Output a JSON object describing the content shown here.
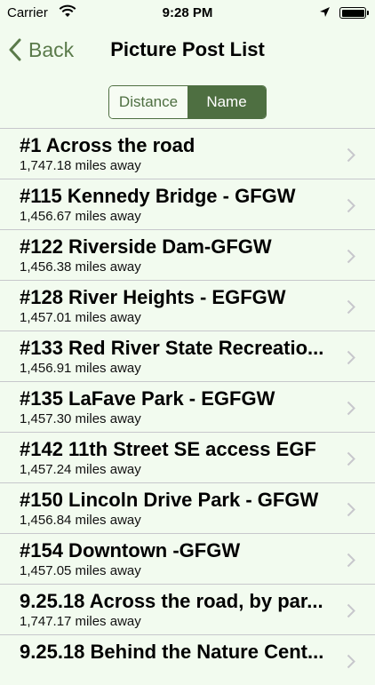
{
  "status_bar": {
    "carrier": "Carrier",
    "time": "9:28 PM",
    "icons": [
      "wifi-icon",
      "location-arrow-icon",
      "battery-icon"
    ]
  },
  "nav": {
    "back_label": "Back",
    "title": "Picture Post List"
  },
  "segments": [
    {
      "label": "Distance",
      "selected": false
    },
    {
      "label": "Name",
      "selected": true
    }
  ],
  "posts": [
    {
      "name": "#1 Across the road",
      "distance": "1,747.18 miles away"
    },
    {
      "name": "#115 Kennedy Bridge - GFGW",
      "distance": "1,456.67 miles away"
    },
    {
      "name": "#122 Riverside Dam-GFGW",
      "distance": "1,456.38 miles away"
    },
    {
      "name": "#128 River Heights - EGFGW",
      "distance": "1,457.01 miles away"
    },
    {
      "name": "#133 Red River State Recreatio...",
      "distance": "1,456.91 miles away"
    },
    {
      "name": "#135 LaFave Park - EGFGW",
      "distance": "1,457.30 miles away"
    },
    {
      "name": "#142 11th Street SE access EGF",
      "distance": "1,457.24 miles away"
    },
    {
      "name": "#150 Lincoln Drive Park - GFGW",
      "distance": "1,456.84 miles away"
    },
    {
      "name": "#154 Downtown -GFGW",
      "distance": "1,457.05 miles away"
    },
    {
      "name": "9.25.18 Across the road, by par...",
      "distance": "1,747.17 miles away"
    },
    {
      "name": "9.25.18 Behind the Nature Cent...",
      "distance": ""
    }
  ],
  "colors": {
    "accent": "#4e6f41",
    "background": "#f2fbef",
    "separator": "#c7c7cc"
  }
}
